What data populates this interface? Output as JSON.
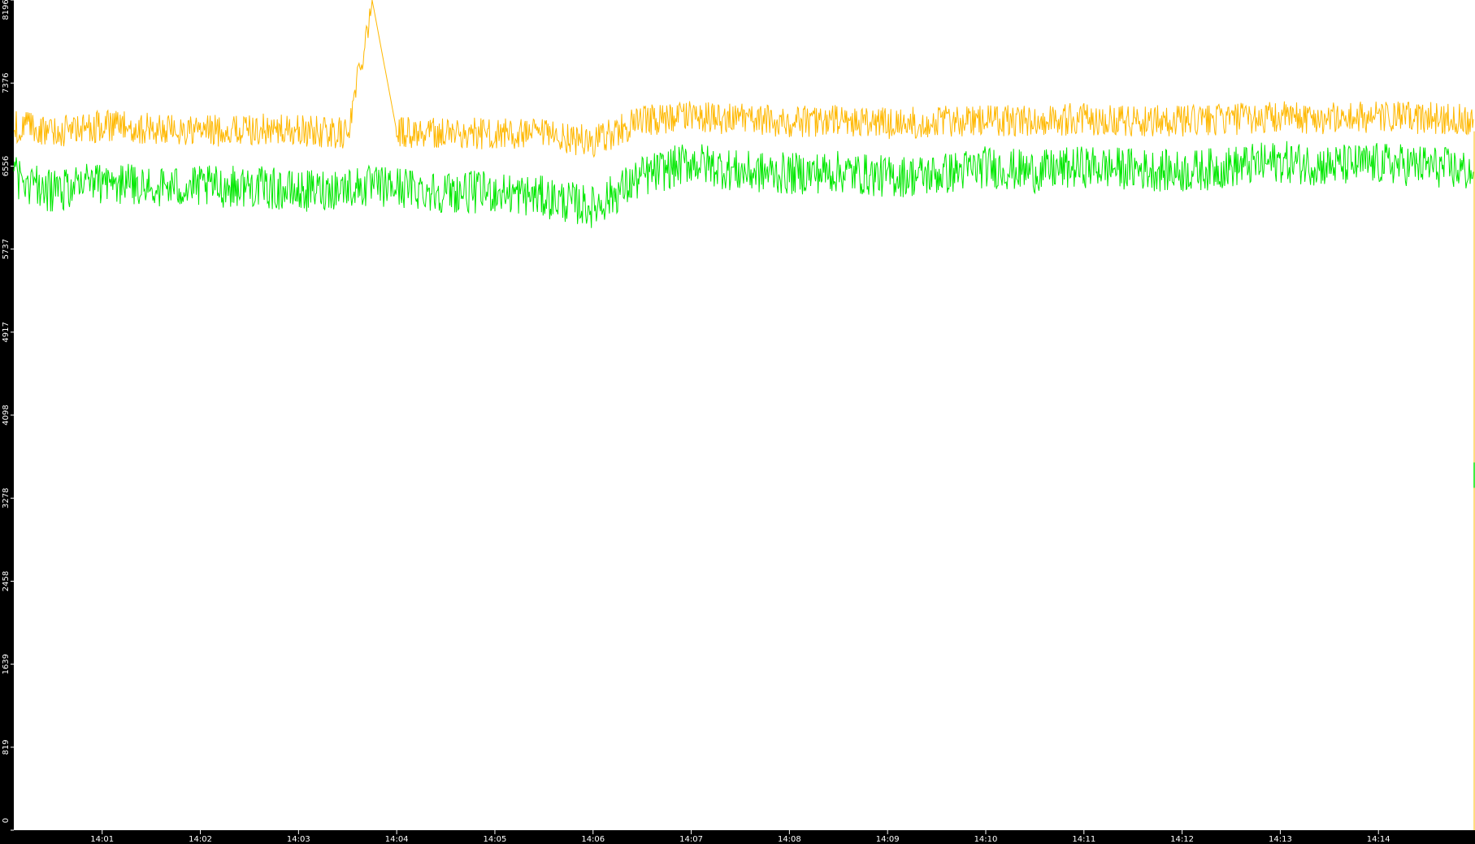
{
  "chart_data": {
    "type": "line",
    "title": "",
    "xlabel": "",
    "ylabel": "",
    "y_ticks": [
      "0",
      "819",
      "1639",
      "2458",
      "3278",
      "4098",
      "4917",
      "5737",
      "6556",
      "7376",
      "8196"
    ],
    "ylim": [
      0,
      8196
    ],
    "x_ticks": [
      "14:01",
      "14:02",
      "14:03",
      "14:04",
      "14:05",
      "14:06",
      "14:07",
      "14:08",
      "14:09",
      "14:10",
      "14:11",
      "14:12",
      "14:13",
      "14:14"
    ],
    "xlim": [
      "14:00:06",
      "14:14:59"
    ],
    "grid": false,
    "legend": "none",
    "background": "#ffffff",
    "axis_background": "#000000",
    "series": [
      {
        "color": "#ffb800",
        "points": [
          {
            "t": "14:00:06",
            "y": 6950
          },
          {
            "t": "14:00:30",
            "y": 6900
          },
          {
            "t": "14:01:00",
            "y": 6950
          },
          {
            "t": "14:01:30",
            "y": 6920
          },
          {
            "t": "14:02:00",
            "y": 6900
          },
          {
            "t": "14:02:30",
            "y": 6920
          },
          {
            "t": "14:03:00",
            "y": 6900
          },
          {
            "t": "14:03:30",
            "y": 6880
          },
          {
            "t": "14:03:45",
            "y": 8196
          },
          {
            "t": "14:04:00",
            "y": 6900
          },
          {
            "t": "14:04:30",
            "y": 6880
          },
          {
            "t": "14:05:00",
            "y": 6870
          },
          {
            "t": "14:05:30",
            "y": 6860
          },
          {
            "t": "14:06:00",
            "y": 6800
          },
          {
            "t": "14:06:30",
            "y": 7000
          },
          {
            "t": "14:07:00",
            "y": 7050
          },
          {
            "t": "14:07:30",
            "y": 7020
          },
          {
            "t": "14:08:00",
            "y": 7000
          },
          {
            "t": "14:08:30",
            "y": 7000
          },
          {
            "t": "14:09:00",
            "y": 6980
          },
          {
            "t": "14:09:30",
            "y": 6990
          },
          {
            "t": "14:10:00",
            "y": 7000
          },
          {
            "t": "14:10:30",
            "y": 7010
          },
          {
            "t": "14:11:00",
            "y": 7020
          },
          {
            "t": "14:11:30",
            "y": 7010
          },
          {
            "t": "14:12:00",
            "y": 7000
          },
          {
            "t": "14:12:30",
            "y": 7020
          },
          {
            "t": "14:13:00",
            "y": 7040
          },
          {
            "t": "14:13:30",
            "y": 7030
          },
          {
            "t": "14:14:00",
            "y": 7040
          },
          {
            "t": "14:14:30",
            "y": 7030
          },
          {
            "t": "14:14:58",
            "y": 7020
          }
        ]
      },
      {
        "color": "#00e800",
        "points": [
          {
            "t": "14:00:06",
            "y": 6450
          },
          {
            "t": "14:00:30",
            "y": 6300
          },
          {
            "t": "14:01:00",
            "y": 6400
          },
          {
            "t": "14:01:30",
            "y": 6350
          },
          {
            "t": "14:02:00",
            "y": 6350
          },
          {
            "t": "14:02:30",
            "y": 6360
          },
          {
            "t": "14:03:00",
            "y": 6300
          },
          {
            "t": "14:03:30",
            "y": 6350
          },
          {
            "t": "14:04:00",
            "y": 6350
          },
          {
            "t": "14:04:30",
            "y": 6300
          },
          {
            "t": "14:05:00",
            "y": 6300
          },
          {
            "t": "14:05:30",
            "y": 6250
          },
          {
            "t": "14:06:00",
            "y": 6150
          },
          {
            "t": "14:06:30",
            "y": 6450
          },
          {
            "t": "14:07:00",
            "y": 6600
          },
          {
            "t": "14:07:30",
            "y": 6500
          },
          {
            "t": "14:08:00",
            "y": 6480
          },
          {
            "t": "14:08:30",
            "y": 6500
          },
          {
            "t": "14:09:00",
            "y": 6450
          },
          {
            "t": "14:09:30",
            "y": 6470
          },
          {
            "t": "14:10:00",
            "y": 6550
          },
          {
            "t": "14:10:30",
            "y": 6500
          },
          {
            "t": "14:11:00",
            "y": 6550
          },
          {
            "t": "14:11:30",
            "y": 6530
          },
          {
            "t": "14:12:00",
            "y": 6500
          },
          {
            "t": "14:12:30",
            "y": 6550
          },
          {
            "t": "14:13:00",
            "y": 6600
          },
          {
            "t": "14:13:30",
            "y": 6560
          },
          {
            "t": "14:14:00",
            "y": 6580
          },
          {
            "t": "14:14:30",
            "y": 6560
          },
          {
            "t": "14:14:58",
            "y": 6500
          }
        ]
      }
    ]
  }
}
